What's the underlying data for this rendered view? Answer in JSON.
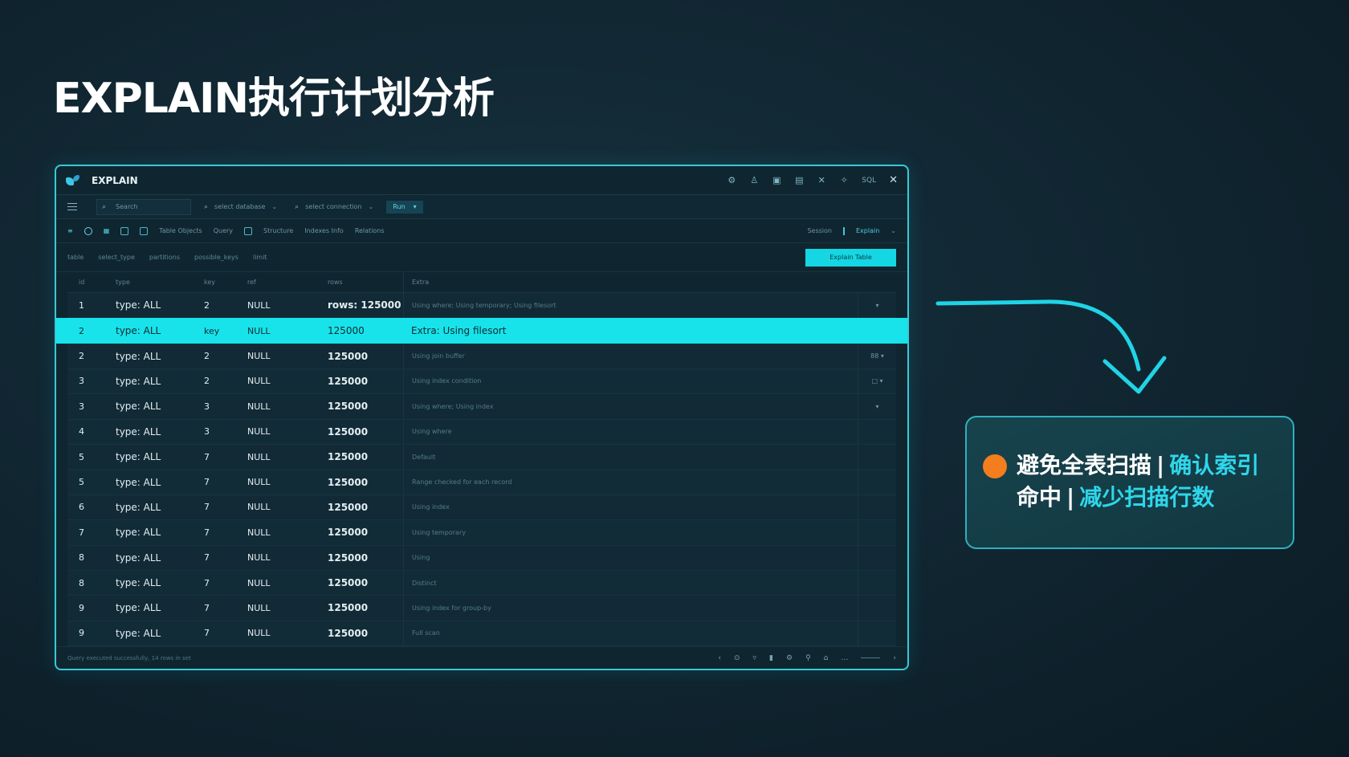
{
  "slide": {
    "title": "EXPLAIN执行计划分析"
  },
  "window": {
    "app_name": "EXPLAIN",
    "toolbar_right_text": "SQL",
    "search_placeholder": "Search",
    "dropdown1": "select database",
    "dropdown2": "select connection",
    "chip": "Run",
    "tabs": [
      "Table Objects",
      "Query",
      "Structure",
      "Indexes Info",
      "Relations"
    ],
    "toolbar2_right": [
      "Session",
      "Explain"
    ],
    "filters": [
      "table",
      "select_type",
      "partitions",
      "possible_keys",
      "limit"
    ],
    "primary_button": "Explain Table",
    "columns": [
      "id",
      "type",
      "key",
      "ref",
      "rows",
      "Extra"
    ],
    "rows": [
      {
        "id": "1",
        "type": "type: ALL",
        "key": "2",
        "ref": "NULL",
        "rows": "rows: 125000",
        "extra": "Using where; Using temporary; Using filesort",
        "act": "▾"
      },
      {
        "id": "2",
        "type": "type: ALL",
        "key": "key",
        "ref": "NULL",
        "rows": "125000",
        "extra": "Extra: Using filesort",
        "act": "",
        "highlight": true
      },
      {
        "id": "2",
        "type": "type: ALL",
        "key": "2",
        "ref": "NULL",
        "rows": "125000",
        "extra": "Using join buffer",
        "act": "88 ▾"
      },
      {
        "id": "3",
        "type": "type: ALL",
        "key": "2",
        "ref": "NULL",
        "rows": "125000",
        "extra": "Using index condition",
        "act": "□ ▾"
      },
      {
        "id": "3",
        "type": "type: ALL",
        "key": "3",
        "ref": "NULL",
        "rows": "125000",
        "extra": "Using where; Using index",
        "act": "▾"
      },
      {
        "id": "4",
        "type": "type: ALL",
        "key": "3",
        "ref": "NULL",
        "rows": "125000",
        "extra": "Using where",
        "act": ""
      },
      {
        "id": "5",
        "type": "type: ALL",
        "key": "7",
        "ref": "NULL",
        "rows": "125000",
        "extra": "Default",
        "act": ""
      },
      {
        "id": "5",
        "type": "type: ALL",
        "key": "7",
        "ref": "NULL",
        "rows": "125000",
        "extra": "Range checked for each record",
        "act": ""
      },
      {
        "id": "6",
        "type": "type: ALL",
        "key": "7",
        "ref": "NULL",
        "rows": "125000",
        "extra": "Using index",
        "act": ""
      },
      {
        "id": "7",
        "type": "type: ALL",
        "key": "7",
        "ref": "NULL",
        "rows": "125000",
        "extra": "Using temporary",
        "act": ""
      },
      {
        "id": "8",
        "type": "type: ALL",
        "key": "7",
        "ref": "NULL",
        "rows": "125000",
        "extra": "Using",
        "act": ""
      },
      {
        "id": "8",
        "type": "type: ALL",
        "key": "7",
        "ref": "NULL",
        "rows": "125000",
        "extra": "Distinct",
        "act": ""
      },
      {
        "id": "9",
        "type": "type: ALL",
        "key": "7",
        "ref": "NULL",
        "rows": "125000",
        "extra": "Using index for group-by",
        "act": ""
      },
      {
        "id": "9",
        "type": "type: ALL",
        "key": "7",
        "ref": "NULL",
        "rows": "125000",
        "extra": "Full scan",
        "act": ""
      }
    ],
    "status_text": "Query executed successfully, 14 rows in set"
  },
  "callout": {
    "line1_a": "避免全表扫描",
    "sep": "|",
    "line1_b": "确认索引",
    "line2_a": "命中",
    "line2_b": "减少扫描行数",
    "dot_color": "#f47d1d",
    "accent_color": "#2fd6ea"
  }
}
